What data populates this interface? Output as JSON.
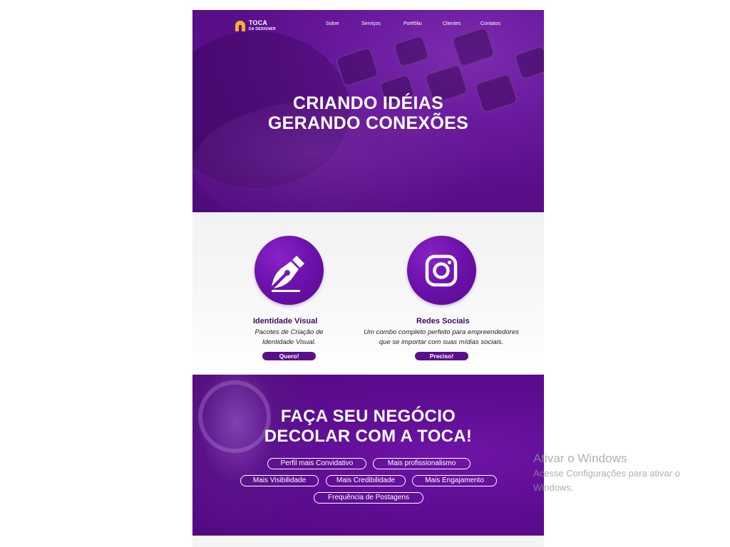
{
  "brand": {
    "line1": "TOCA",
    "line2": "DA DESIGNER",
    "accent": "#f5b324"
  },
  "nav": {
    "items": [
      {
        "label": "Sobre"
      },
      {
        "label": "Serviços"
      },
      {
        "label": "Portfólio"
      },
      {
        "label": "Clientes"
      },
      {
        "label": "Contatos"
      }
    ]
  },
  "hero": {
    "line1": "CRIANDO IDÉIAS",
    "line2": "GERANDO CONEXÕES"
  },
  "services": [
    {
      "icon": "pen-nib-icon",
      "title": "Identidade Visual",
      "desc1": "Pacotes de Criação de",
      "desc2": "Identidade Visual.",
      "button": "Quero!"
    },
    {
      "icon": "instagram-icon",
      "title": "Redes Sociais",
      "desc1": "Um combo completo perfeito para empreendedores",
      "desc2": "que se importar com suas mídias sociais.",
      "button": "Preciso!"
    }
  ],
  "cta": {
    "line1": "FAÇA SEU NEGÓCIO",
    "line2": "DECOLAR COM A TOCA!",
    "pills": [
      "Perfil mais Convidativo",
      "Mais profissionalismo",
      "Mais Visibilidade",
      "Mais Credibilidade",
      "Mais Engajamento",
      "Frequência de Postagens"
    ]
  },
  "watermark": {
    "title": "Ativar o Windows",
    "line1": "Acesse Configurações para ativar o",
    "line2": "Windows."
  },
  "colors": {
    "purple_dark": "#52097f",
    "purple_main": "#6a1a9e",
    "button_bg": "#5a0f8a",
    "title_text": "#3d0a66"
  }
}
